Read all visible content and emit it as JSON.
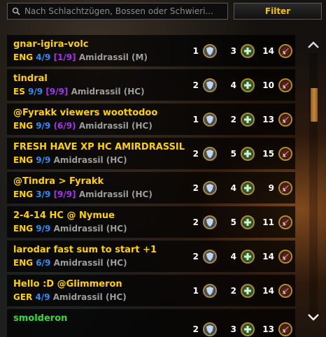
{
  "search": {
    "placeholder": "Nach Schlachtzügen, Bossen oder Schwieri..."
  },
  "filter_label": "Filter",
  "groups": [
    {
      "title": "gnar-igira-volc",
      "lang": "ENG",
      "prog": "4/9",
      "alt": "[1/9]",
      "raid": "Amidrassil (M)",
      "tanks": "1",
      "heals": "3",
      "dps": "14"
    },
    {
      "title": "tindral",
      "lang": "ES",
      "prog": "9/9",
      "alt": "[9/9]",
      "raid": "Amidrassil (HC)",
      "tanks": "2",
      "heals": "4",
      "dps": "10"
    },
    {
      "title": "@Fyrakk viewers woottodoo",
      "lang": "ENG",
      "prog": "9/9",
      "alt": "(6/9)",
      "raid": "Amidrassil (HC)",
      "tanks": "1",
      "heals": "2",
      "dps": "13"
    },
    {
      "title": "FRESH HAVE XP HC AMIRDRASSIL",
      "lang": "ENG",
      "prog": "9/9",
      "alt": "",
      "raid": "Amidrassil (HC)",
      "tanks": "2",
      "heals": "5",
      "dps": "15"
    },
    {
      "title": "@Tindra > Fyrakk",
      "lang": "ENG",
      "prog": "3/9",
      "alt": "[9/9]",
      "raid": "Amidrassil (HC)",
      "tanks": "2",
      "heals": "4",
      "dps": "9"
    },
    {
      "title": "2-4-14 HC @ Nymue",
      "lang": "ENG",
      "prog": "9/9",
      "alt": "",
      "raid": "Amidrassil (HC)",
      "tanks": "2",
      "heals": "5",
      "dps": "11"
    },
    {
      "title": "larodar fast sum to start +1",
      "lang": "ENG",
      "prog": "6/9",
      "alt": "",
      "raid": "Amidrassil (HC)",
      "tanks": "2",
      "heals": "4",
      "dps": "14"
    },
    {
      "title": "Hello :D @Glimmeron",
      "lang": "GER",
      "prog": "4/9",
      "alt": "",
      "raid": "Amidrassil (HC)",
      "tanks": "1",
      "heals": "2",
      "dps": "14"
    },
    {
      "title": "smolderon",
      "lang": "",
      "prog": "",
      "alt": "",
      "raid": "",
      "tanks": "2",
      "heals": "3",
      "dps": "13"
    }
  ],
  "icons": {
    "search": "search-icon",
    "tank": "tank-role-icon",
    "heal": "healer-role-icon",
    "dps": "damage-role-icon",
    "up": "scroll-up-icon",
    "down": "scroll-down-icon"
  },
  "colors": {
    "title": "#ffd100",
    "progress": "#2e8df2",
    "alt_progress": "#a335ee",
    "raid": "#9d9d9d"
  }
}
